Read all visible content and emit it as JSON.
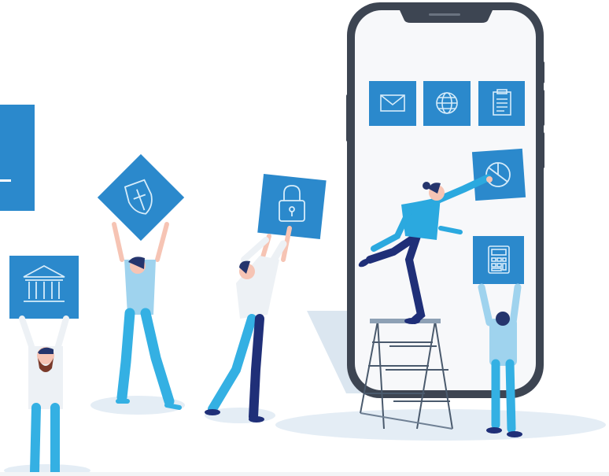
{
  "colors": {
    "tile_blue": "#2b89cc",
    "tile_icon": "#d6ecfa",
    "phone_frame": "#3d4552",
    "phone_screen": "#f7f8fa",
    "floor_shadow": "#dde8f2",
    "skin": "#f6c4b4",
    "hair_dark": "#25356d",
    "shirt_light": "#edf1f5",
    "shirt_sky": "#9fd3ee",
    "pants_cyan": "#34b0e3",
    "pants_navy": "#1f2f78",
    "beard_brown": "#7a3a2a",
    "ladder": "#5a6a7a"
  },
  "icons": [
    "mail-icon",
    "globe-icon",
    "clipboard-icon",
    "pie-chart-icon",
    "calculator-icon",
    "shield-icon",
    "padlock-icon",
    "bank-icon"
  ]
}
